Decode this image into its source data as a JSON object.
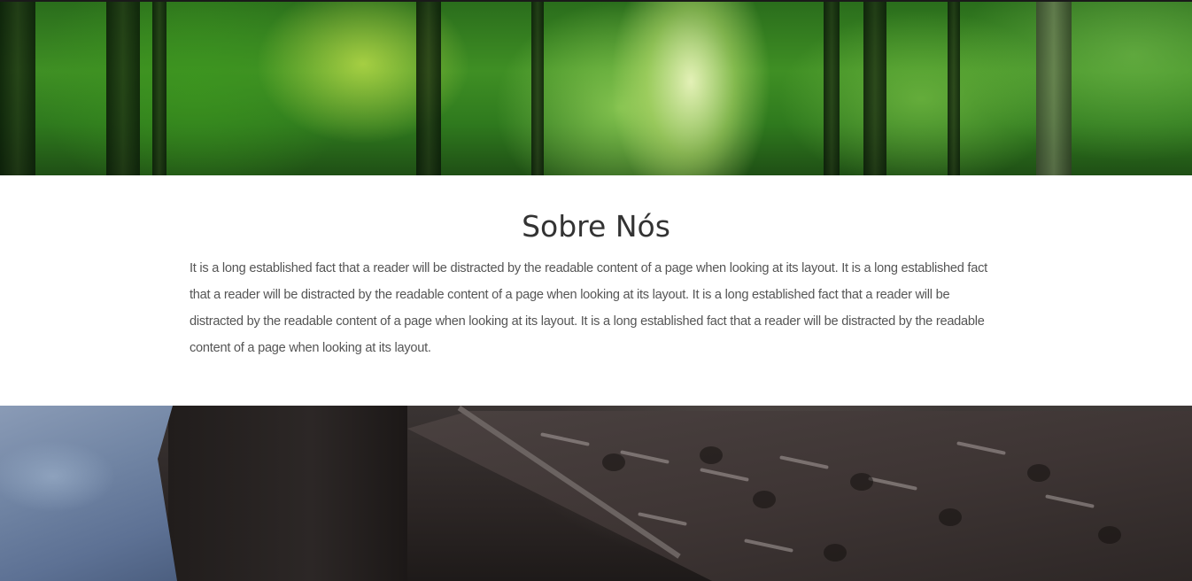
{
  "about": {
    "title": "Sobre Nós",
    "body": "It is a long established fact that a reader will be distracted by the readable content of a page when looking at its layout. It is a long established fact that a reader will be distracted by the readable content of a page when looking at its layout. It is a long established fact that a reader will be distracted by the readable content of a page when looking at its layout. It is a long established fact that a reader will be distracted by the readable content of a page when looking at its layout."
  },
  "colors": {
    "title": "#333333",
    "body_text": "#555555",
    "section_background": "#ffffff"
  }
}
